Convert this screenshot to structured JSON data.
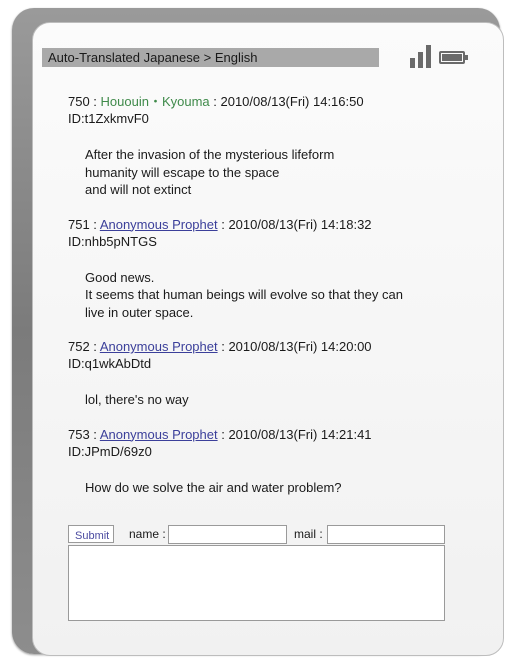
{
  "status_bar": {
    "title": "Auto-Translated  Japanese > English"
  },
  "device": {
    "signal_icon": "signal-bars-icon",
    "battery_icon": "battery-icon"
  },
  "posts": [
    {
      "number": "750 : ",
      "name": "Hououin・Kyouma",
      "date": " : 2010/08/13(Fri) 14:16:50",
      "id": "ID:t1ZxkmvF0",
      "body": [
        "After the invasion of the mysterious lifeform",
        "humanity will escape to the space",
        "and will not extinct"
      ]
    },
    {
      "number": "751 : ",
      "name": "Anonymous Prophet",
      "date": " : 2010/08/13(Fri) 14:18:32",
      "id": "ID:nhb5pNTGS",
      "body": [
        "Good news.",
        "It seems that human beings will evolve so that they can",
        "live in outer space."
      ]
    },
    {
      "number": "752 : ",
      "name": "Anonymous Prophet",
      "date": " : 2010/08/13(Fri) 14:20:00",
      "id": "ID:q1wkAbDtd",
      "body": [
        "lol, there's no way"
      ]
    },
    {
      "number": "753 : ",
      "name": "Anonymous Prophet",
      "date": " : 2010/08/13(Fri) 14:21:41",
      "id": "ID:JPmD/69z0",
      "body": [
        "How do we solve the air and water problem?"
      ]
    }
  ],
  "form": {
    "submit_label": "Submit",
    "name_label": "name :",
    "mail_label": "mail :",
    "name_value": "",
    "mail_value": "",
    "message_value": ""
  },
  "colors": {
    "name_green": "#3f8a4a",
    "name_link": "#3b3f9a",
    "frame": "#8a8a8a"
  }
}
